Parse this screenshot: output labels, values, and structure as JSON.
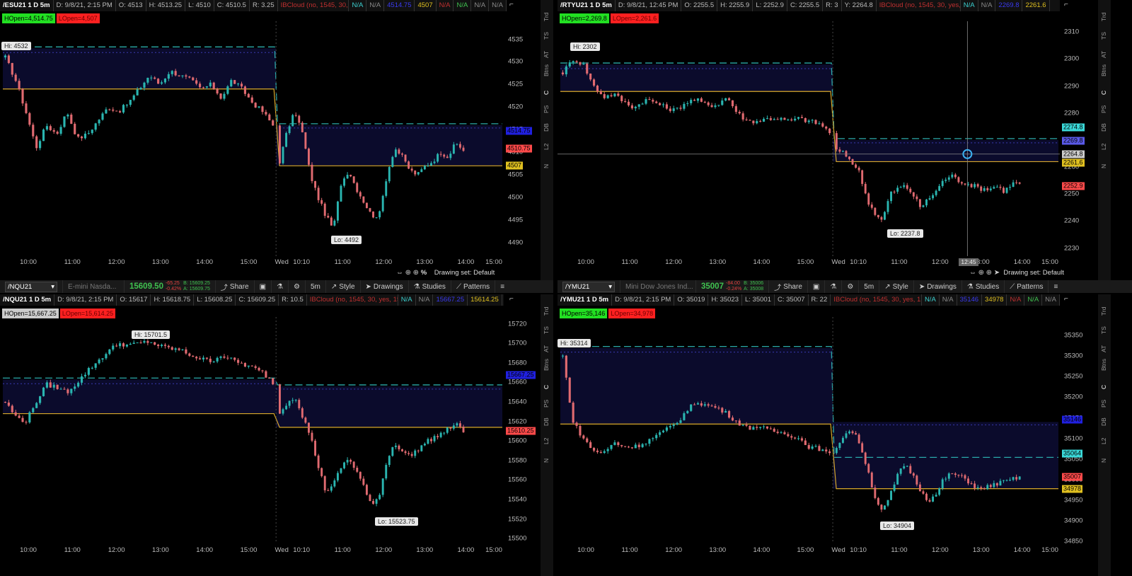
{
  "theme": {
    "up": "#2ab5b0",
    "down": "#e06a70",
    "cloud": "#0b0b2c",
    "cyan_line": "#2aa9a9",
    "yellow_line": "#d8a82a",
    "navy_line": "#3a3ab0"
  },
  "right_tabs": [
    "Trd",
    "TS",
    "AT",
    "Btns",
    "C",
    "PS",
    "DB",
    "L2",
    "N"
  ],
  "panels": [
    {
      "header": {
        "symbol": "/ESU21 1 D 5m",
        "date": "D: 9/8/21, 2:15 PM",
        "open": "O: 4513",
        "high": "H: 4513.25",
        "low": "L: 4510",
        "close": "C: 4510.5",
        "range": "R: 3.25",
        "study": "IBCloud (no, 1545, 30, yes, 15, Blue)",
        "v1": "N/A",
        "v2": "N/A",
        "v3": "4514.75",
        "v4": "4507",
        "v5": "N/A",
        "v6": "N/A",
        "v7": "N/A",
        "v8": "N/A"
      },
      "badges": [
        "HOpen=4,514.75",
        "LOpen=4,507"
      ],
      "y_labels": [
        "4535",
        "4530",
        "4525",
        "4520",
        "4515",
        "4510",
        "4505",
        "4500",
        "4495",
        "4490"
      ],
      "price_tags": [
        {
          "text": "4514.75",
          "color": "#2020e0"
        },
        {
          "text": "4510.75",
          "color": "#ff4a4a"
        },
        {
          "text": "4507",
          "color": "#e0c020"
        }
      ],
      "x_labels": [
        "10:00",
        "11:00",
        "12:00",
        "13:00",
        "14:00",
        "15:00",
        "Wed",
        "10:10",
        "11:00",
        "12:00",
        "13:00",
        "14:00",
        "15:00"
      ],
      "hi": "Hi: 4532",
      "lo": "Lo: 4492",
      "bottom": {
        "drawing_set": "Drawing set: Default",
        "pct": "%"
      }
    },
    {
      "header": {
        "symbol": "/RTYU21 1 D 5m",
        "date": "D: 9/8/21, 12:45 PM",
        "open": "O: 2255.5",
        "high": "H: 2255.9",
        "low": "L: 2252.9",
        "close": "C: 2255.5",
        "range": "R: 3",
        "y": "Y: 2264.8",
        "study": "IBCloud (no, 1545, 30, yes, 15, Blue)",
        "v1": "N/A",
        "v2": "N/A",
        "v3": "2269.8",
        "v4": "2261.6"
      },
      "badges": [
        "HOpen=2,269.8",
        "LOpen=2,261.6"
      ],
      "y_labels": [
        "2310",
        "2300",
        "2290",
        "2280",
        "2270",
        "2260",
        "2250",
        "2240",
        "2230"
      ],
      "price_tags": [
        {
          "text": "2274.8",
          "color": "#3ad8d8"
        },
        {
          "text": "2269.8",
          "color": "#5a5ae8"
        },
        {
          "text": "2264.8",
          "color": "#cccccc"
        },
        {
          "text": "2261.6",
          "color": "#e0c020"
        },
        {
          "text": "2252.9",
          "color": "#ff4a4a"
        }
      ],
      "x_labels": [
        "10:00",
        "11:00",
        "12:00",
        "13:00",
        "14:00",
        "15:00",
        "Wed",
        "10:10",
        "11:00",
        "12:00",
        "13:00",
        "14:00",
        "15:00"
      ],
      "hi": "Hi: 2302",
      "lo": "Lo: 2237.8",
      "time_chip": "12:45",
      "bottom": {
        "drawing_set": "Drawing set: Default"
      }
    },
    {
      "toolbar": {
        "symbol": "/NQU21",
        "desc": "E-mini Nasda...",
        "price": "15609.50",
        "chg1": "-65.25",
        "chg2": "-0.42%",
        "bid": "B: 15609.25",
        "ask": "A: 15609.75",
        "share": "Share",
        "time": "5m",
        "style": "Style",
        "drawings": "Drawings",
        "studies": "Studies",
        "patterns": "Patterns"
      },
      "header": {
        "symbol": "/NQU21 1 D 5m",
        "date": "D: 9/8/21, 2:15 PM",
        "open": "O: 15617",
        "high": "H: 15618.75",
        "low": "L: 15608.25",
        "close": "C: 15609.25",
        "range": "R: 10.5",
        "study": "IBCloud (no, 1545, 30, yes, 15, Blue)",
        "v1": "N/A",
        "v2": "N/A",
        "v3": "15667.25",
        "v4": "15614.25"
      },
      "badges": [
        "HOpen=15,667.25",
        "LOpen=15,614.25"
      ],
      "y_labels": [
        "15720",
        "15700",
        "15680",
        "15660",
        "15640",
        "15620",
        "15600",
        "15580",
        "15560",
        "15540",
        "15520",
        "15500"
      ],
      "price_tags": [
        {
          "text": "15667.25",
          "color": "#2020e0"
        },
        {
          "text": "15610.25",
          "color": "#ff4a4a"
        }
      ],
      "x_labels": [
        "10:00",
        "11:00",
        "12:00",
        "13:00",
        "14:00",
        "15:00",
        "Wed",
        "10:10",
        "11:00",
        "12:00",
        "13:00",
        "14:00",
        "15:00"
      ],
      "hi": "Hi: 15701.5",
      "lo": "Lo: 15523.75"
    },
    {
      "toolbar": {
        "symbol": "/YMU21",
        "desc": "Mini Dow Jones Ind...",
        "price": "35007",
        "chg1": "-84.00",
        "chg2": "-0.24%",
        "bid": "B: 35006",
        "ask": "A: 35008",
        "share": "Share",
        "time": "5m",
        "style": "Style",
        "drawings": "Drawings",
        "studies": "Studies",
        "patterns": "Patterns"
      },
      "header": {
        "symbol": "/YMU21 1 D 5m",
        "date": "D: 9/8/21, 2:15 PM",
        "open": "O: 35019",
        "high": "H: 35023",
        "low": "L: 35001",
        "close": "C: 35007",
        "range": "R: 22",
        "study": "IBCloud (no, 1545, 30, yes, 15, Blue)",
        "v1": "N/A",
        "v2": "N/A",
        "v3": "35146",
        "v4": "34978",
        "v5": "N/A",
        "v6": "N/A",
        "v7": "N/A"
      },
      "badges": [
        "HOpen=35,146",
        "LOpen=34,978"
      ],
      "y_labels": [
        "35350",
        "35300",
        "35250",
        "35200",
        "35150",
        "35100",
        "35050",
        "35000",
        "34950",
        "34900",
        "34850"
      ],
      "price_tags": [
        {
          "text": "35146",
          "color": "#2020e0"
        },
        {
          "text": "35064",
          "color": "#3ad8d8"
        },
        {
          "text": "35007",
          "color": "#ff4a4a"
        },
        {
          "text": "34978",
          "color": "#e0c020"
        }
      ],
      "x_labels": [
        "10:00",
        "11:00",
        "12:00",
        "13:00",
        "14:00",
        "15:00",
        "Wed",
        "10:10",
        "11:00",
        "12:00",
        "13:00",
        "14:00",
        "15:00"
      ],
      "hi": "Hi: 35314",
      "lo": "Lo: 34904"
    }
  ],
  "chart_data": [
    {
      "type": "candlestick",
      "symbol": "/ESU21",
      "ylim": [
        4487,
        4539
      ],
      "day1_path": [
        4531,
        4526,
        4519,
        4511,
        4516,
        4514,
        4519,
        4513,
        4514,
        4517,
        4520,
        4519,
        4521,
        4524,
        4527,
        4525,
        4528,
        4527,
        4526,
        4524,
        4525,
        4522,
        4526,
        4524,
        4521,
        4519,
        4516
      ],
      "day2_path": [
        4508,
        4515,
        4519,
        4514,
        4505,
        4500,
        4496,
        4493,
        4503,
        4506,
        4502,
        4499,
        4496,
        4496,
        4505,
        4511,
        4509,
        4506,
        4505,
        4507,
        4508,
        4510,
        4509,
        4512,
        4510.5
      ],
      "day1_cloud": [
        4533,
        4524
      ],
      "day2_cloud": [
        4516,
        4507
      ],
      "hi": 4532,
      "lo": 4492,
      "crosshair": null
    },
    {
      "type": "candlestick",
      "symbol": "/RTYU21",
      "ylim": [
        2227,
        2314
      ],
      "day1_path": [
        2295,
        2300,
        2298,
        2290,
        2286,
        2287,
        2284,
        2282,
        2285,
        2284,
        2282,
        2281,
        2284,
        2285,
        2283,
        2283,
        2286,
        2280,
        2277,
        2277,
        2278,
        2278,
        2277,
        2278,
        2277,
        2276,
        2273
      ],
      "day2_path": [
        2266,
        2265,
        2262,
        2258,
        2248,
        2243,
        2240,
        2250,
        2252,
        2253,
        2250,
        2245,
        2248,
        2251,
        2255,
        2257,
        2255,
        2254,
        2253,
        2252,
        2252,
        2253,
        2251,
        2254,
        2254
      ],
      "day1_cloud": [
        2298,
        2288
      ],
      "day2_cloud": [
        2270,
        2262
      ],
      "hi": 2302,
      "lo": 2237.8,
      "crosshair": 2264.8
    },
    {
      "type": "candlestick",
      "symbol": "/NQU21",
      "ylim": [
        15495,
        15727
      ],
      "day1_path": [
        15640,
        15625,
        15620,
        15640,
        15658,
        15655,
        15650,
        15660,
        15672,
        15682,
        15692,
        15700,
        15698,
        15700,
        15702,
        15697,
        15695,
        15693,
        15688,
        15684,
        15682,
        15688,
        15683,
        15679,
        15675,
        15670,
        15660
      ],
      "day2_path": [
        15628,
        15640,
        15646,
        15625,
        15605,
        15575,
        15548,
        15555,
        15573,
        15582,
        15570,
        15553,
        15532,
        15545,
        15580,
        15598,
        15590,
        15584,
        15591,
        15598,
        15603,
        15607,
        15612,
        15618,
        15609
      ],
      "day1_cloud": [
        15663,
        15628
      ],
      "day2_cloud": [
        15656,
        15614
      ],
      "hi": 15701.5,
      "lo": 15523.75,
      "crosshair": null
    },
    {
      "type": "candlestick",
      "symbol": "/YMU21",
      "ylim": [
        34845,
        35395
      ],
      "day1_path": [
        35300,
        35140,
        35100,
        35070,
        35065,
        35090,
        35080,
        35080,
        35090,
        35105,
        35120,
        35135,
        35165,
        35190,
        35180,
        35175,
        35160,
        35140,
        35125,
        35130,
        35120,
        35115,
        35110,
        35100,
        35080,
        35075,
        35060
      ],
      "day2_path": [
        35080,
        35110,
        35120,
        35090,
        35030,
        34960,
        34920,
        34960,
        35010,
        35040,
        35010,
        34975,
        34950,
        34960,
        35000,
        35015,
        35010,
        35000,
        34985,
        34975,
        34985,
        34990,
        34995,
        35000,
        35007
      ],
      "day1_cloud": [
        35320,
        35135
      ],
      "day2_cloud": [
        35140,
        34978
      ],
      "hi": 35314,
      "lo": 34904,
      "crosshair": null
    }
  ]
}
